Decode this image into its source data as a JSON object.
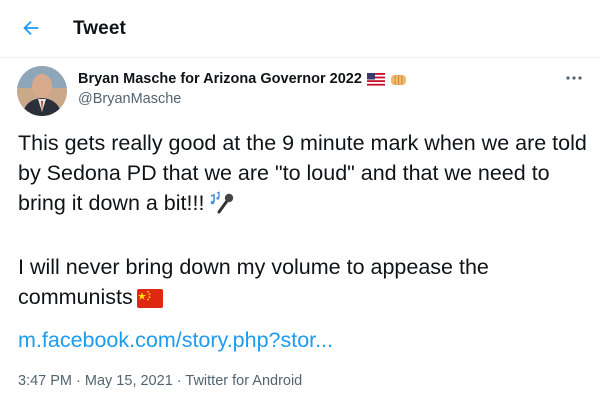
{
  "header": {
    "title": "Tweet",
    "back_icon": "arrow-left-icon",
    "accent": "#1d9bf0"
  },
  "author": {
    "display_name": "Bryan Masche for Arizona Governor 2022",
    "handle": "@BryanMasche",
    "name_emojis": [
      "us-flag-icon",
      "fist-bump-icon"
    ]
  },
  "tweet": {
    "line1": "This gets really good at the 9 minute mark when we are told by Sedona PD that we are \"to loud\" and that we need to bring it down a bit!!!",
    "line1_emoji": "music-microphone-icon",
    "line2": "I will never bring down my volume to appease the communists",
    "line2_emoji": "china-flag-icon",
    "link": "m.facebook.com/story.php?stor..."
  },
  "meta": {
    "time": "3:47 PM",
    "separator": " · ",
    "date": "May 15, 2021",
    "source": "Twitter for Android"
  },
  "colors": {
    "text": "#0f1419",
    "secondary": "#536471",
    "link": "#1d9bf0",
    "divider": "#eff3f4"
  }
}
